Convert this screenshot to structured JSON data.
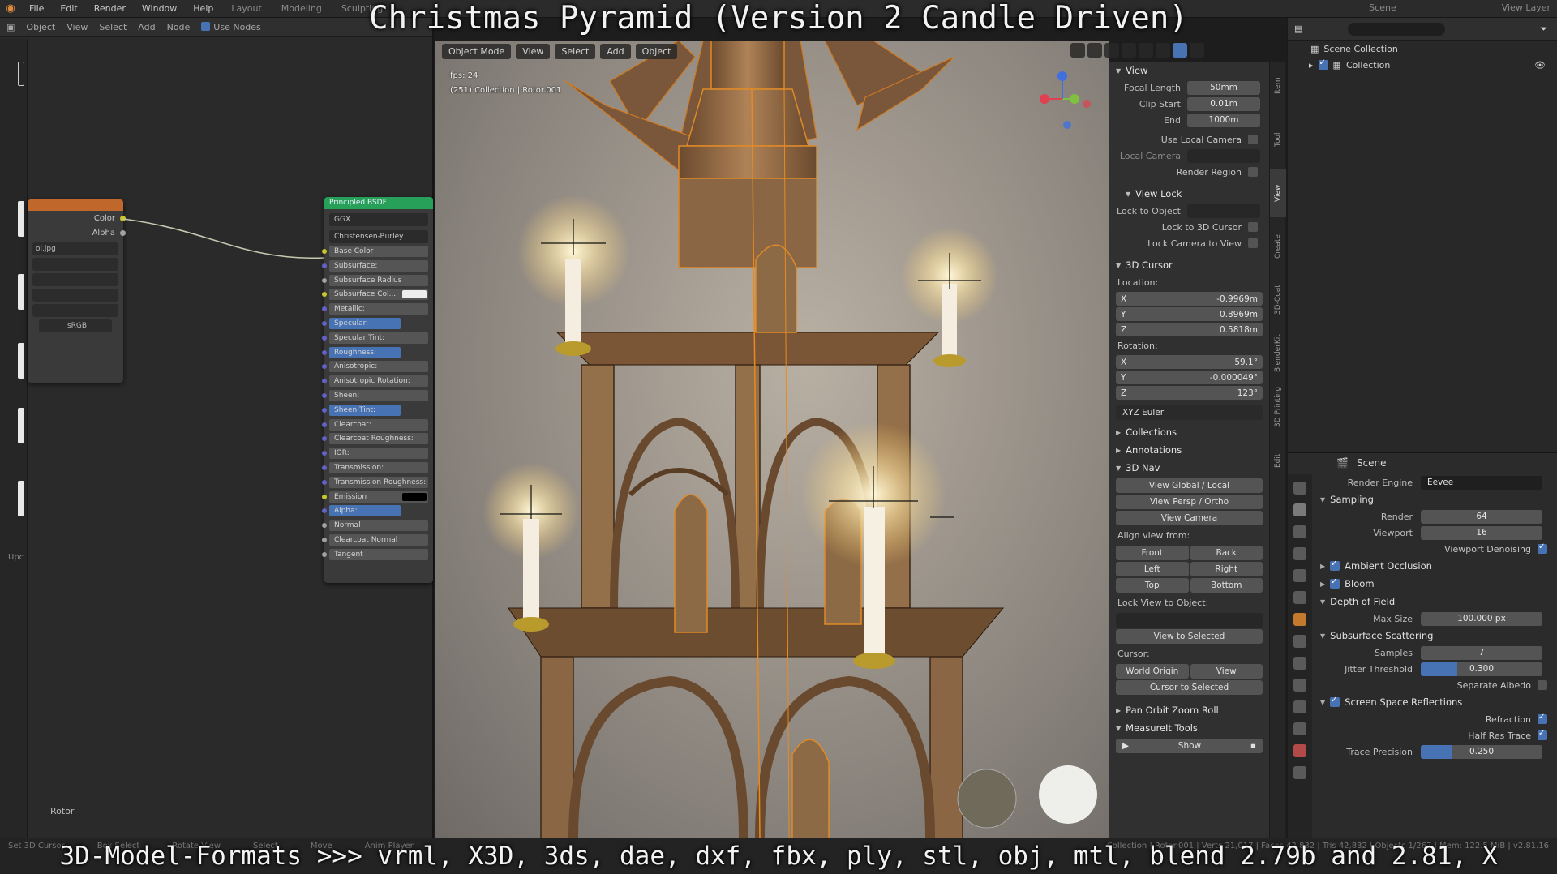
{
  "overlay": {
    "title": "Christmas Pyramid (Version 2 Candle Driven)",
    "formats": "3D-Model-Formats >>> vrml, X3D, 3ds, dae, dxf, fbx, ply, stl, obj, mtl, blend 2.79b and 2.81, X"
  },
  "menubar": {
    "items": [
      "File",
      "Edit",
      "Render",
      "Window",
      "Help"
    ],
    "workspaces": [
      "Layout",
      "Modeling",
      "Sculpting"
    ],
    "scene": "Scene",
    "view_layer": "View Layer"
  },
  "node_editor": {
    "header": [
      "Object",
      "View",
      "Select",
      "Add",
      "Node",
      "Use Nodes"
    ],
    "image_node": {
      "outputs": [
        "Color",
        "Alpha"
      ],
      "image_name": "ol.jpg",
      "colorspace": "sRGB"
    },
    "bsdf": {
      "title": "Principled BSDF",
      "distribution": "GGX",
      "subsurface_method": "Christensen-Burley",
      "inputs": [
        "Base Color",
        "Subsurface:",
        "Subsurface Radius",
        "Subsurface Col...",
        "Metallic:",
        "Specular:",
        "Specular Tint:",
        "Roughness:",
        "Anisotropic:",
        "Anisotropic Rotation:",
        "Sheen:",
        "Sheen Tint:",
        "Clearcoat:",
        "Clearcoat Roughness:",
        "IOR:",
        "Transmission:",
        "Transmission Roughness:",
        "Emission",
        "Alpha:",
        "Normal",
        "Clearcoat Normal",
        "Tangent"
      ]
    },
    "bottom_label": "Rotor",
    "up_label": "Upc"
  },
  "viewport": {
    "header": [
      "Object Mode",
      "View",
      "Select",
      "Add",
      "Object"
    ],
    "overlay_line1": "fps: 24",
    "overlay_line2": "(251) Collection | Rotor.001"
  },
  "npanel": {
    "tabs": [
      "Item",
      "Tool",
      "View",
      "Create",
      "3D-Coat",
      "BlenderKit",
      "3D Printing",
      "Edit"
    ],
    "view": {
      "label": "View",
      "focal_length_label": "Focal Length",
      "focal_length": "50mm",
      "clip_start_label": "Clip Start",
      "clip_start": "0.01m",
      "end_label": "End",
      "end": "1000m",
      "use_local_camera": "Use Local Camera",
      "local_camera": "Local Camera",
      "render_region": "Render Region"
    },
    "view_lock": {
      "label": "View Lock",
      "lock_to_object": "Lock to Object",
      "lock_to_3d_cursor": "Lock to 3D Cursor",
      "lock_camera_to_view": "Lock Camera to View"
    },
    "cursor": {
      "label": "3D Cursor",
      "location_label": "Location:",
      "x": "-0.9969m",
      "y": "0.8969m",
      "z": "0.5818m",
      "rotation_label": "Rotation:",
      "rx": "59.1°",
      "ry": "-0.000049°",
      "rz": "123°",
      "mode": "XYZ Euler"
    },
    "collapsed": [
      "Collections",
      "Annotations"
    ],
    "nav": {
      "label": "3D Nav",
      "buttons": [
        "View Global / Local",
        "View Persp / Ortho",
        "View Camera"
      ],
      "align_label": "Align view from:",
      "align": [
        "Front",
        "Back",
        "Left",
        "Right",
        "Top",
        "Bottom"
      ],
      "lock_view_label": "Lock View to Object:",
      "view_to_selected": "View to Selected",
      "cursor_label": "Cursor:",
      "world_origin": "World Origin",
      "view": "View",
      "cursor_to_selected": "Cursor to Selected"
    },
    "pan_orbit": "Pan Orbit Zoom Roll",
    "measureit": "MeasureIt Tools",
    "show": "Show"
  },
  "outliner": {
    "scene_collection": "Scene Collection",
    "collection": "Collection"
  },
  "properties": {
    "scene_label": "Scene",
    "render_engine_label": "Render Engine",
    "render_engine": "Eevee",
    "sampling": "Sampling",
    "render_label": "Render",
    "render": "64",
    "viewport_label": "Viewport",
    "viewport": "16",
    "viewport_denoising": "Viewport Denoising",
    "ambient_occlusion": "Ambient Occlusion",
    "bloom": "Bloom",
    "depth_of_field": "Depth of Field",
    "max_size_label": "Max Size",
    "max_size": "100.000 px",
    "subsurface_scattering": "Subsurface Scattering",
    "samples_label": "Samples",
    "samples": "7",
    "jitter_label": "Jitter Threshold",
    "jitter": "0.300",
    "jitter_fraction": 0.3,
    "separate_albedo": "Separate Albedo",
    "ssr": "Screen Space Reflections",
    "refraction": "Refraction",
    "half_res_trace": "Half Res Trace",
    "trace_precision_label": "Trace Precision",
    "trace_precision": "0.250",
    "trace_fraction": 0.25
  },
  "statusbar": {
    "items": [
      "Set 3D Cursor",
      "Box Select",
      "Rotate View",
      "Select",
      "Move",
      "Anim Player"
    ],
    "stats": "Collection | Rotor.001 | Verts 21,017 | Faces 42,832 | Tris 42,832 | Objects 1/267 | Mem: 122.5 MiB | v2.81.16"
  }
}
